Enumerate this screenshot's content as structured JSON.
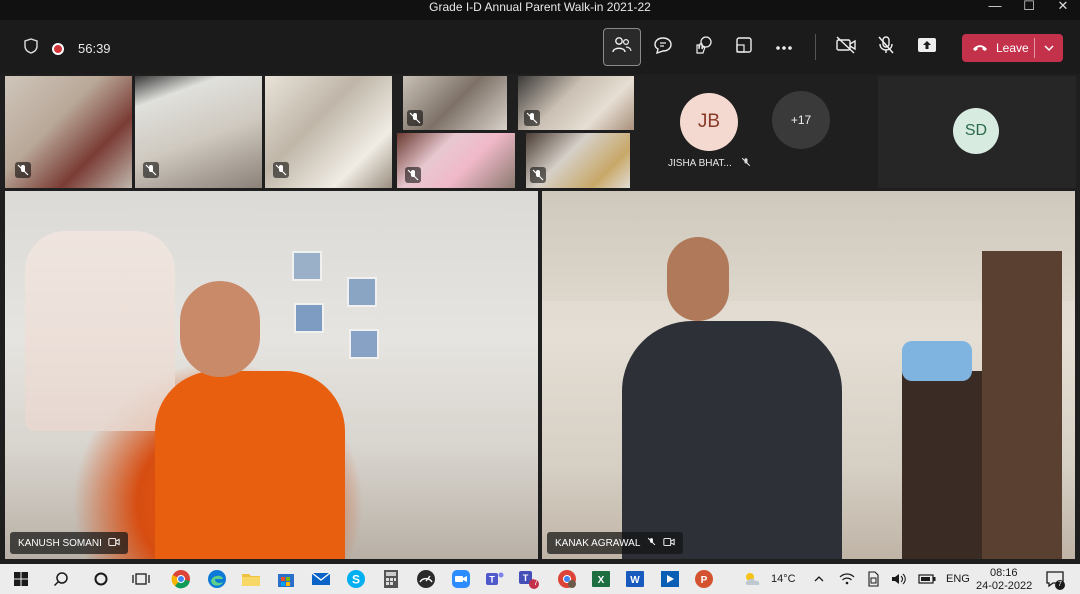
{
  "window": {
    "title": "Grade I-D Annual Parent Walk-in 2021-22",
    "minimize": "—",
    "maximize": "☐",
    "close": "✕"
  },
  "meeting": {
    "timer": "56:39",
    "leave_label": "Leave"
  },
  "participants": {
    "jb_initials": "JB",
    "jb_name": "JISHA BHAT...",
    "overflow_count": "+17",
    "sd_initials": "SD"
  },
  "main_tiles": [
    {
      "name": "KANUSH SOMANI"
    },
    {
      "name": "KANAK AGRAWAL"
    }
  ],
  "taskbar": {
    "weather": "14°C",
    "language": "ENG",
    "time": "08:16",
    "date": "24-02-2022",
    "notification_count": "7",
    "teams_badge": "7"
  },
  "colors": {
    "leave": "#c4314b",
    "jb_avatar": "#f4d9d0",
    "sd_avatar": "#d7ebe0",
    "overflow": "#3a3a3a"
  }
}
